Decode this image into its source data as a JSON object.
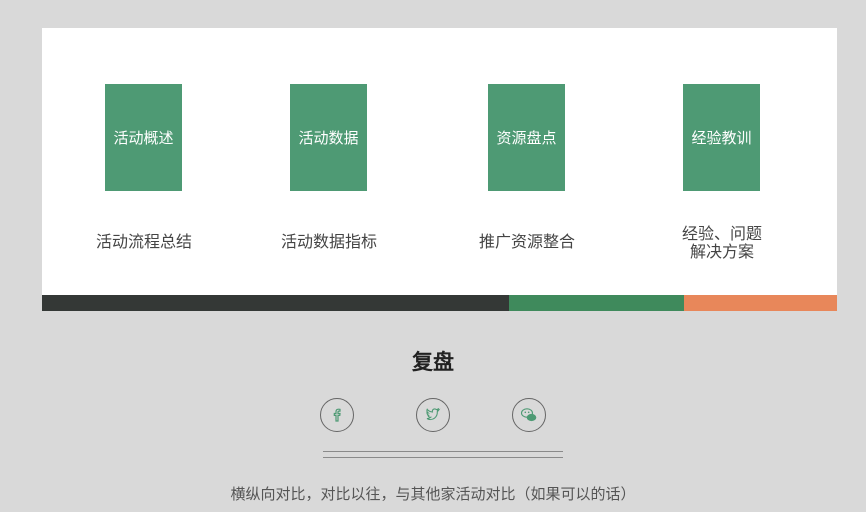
{
  "tiles": [
    {
      "label": "活动概述",
      "caption_line1": "活动流程总结",
      "caption_line2": ""
    },
    {
      "label": "活动数据",
      "caption_line1": "活动数据指标",
      "caption_line2": ""
    },
    {
      "label": "资源盘点",
      "caption_line1": "推广资源整合",
      "caption_line2": ""
    },
    {
      "label": "经验教训",
      "caption_line1": "经验、问题",
      "caption_line2": "解决方案"
    }
  ],
  "title": "复盘",
  "social": [
    "facebook-icon",
    "twitter-icon",
    "wechat-icon"
  ],
  "caption": "横纵向对比，对比以往，与其他家活动对比（如果可以的话）",
  "colors": {
    "tile": "#4e9a74",
    "bar_dark": "#343836",
    "bar_green": "#3f8a5c",
    "bar_orange": "#e8875a",
    "background": "#d9d9d9"
  }
}
